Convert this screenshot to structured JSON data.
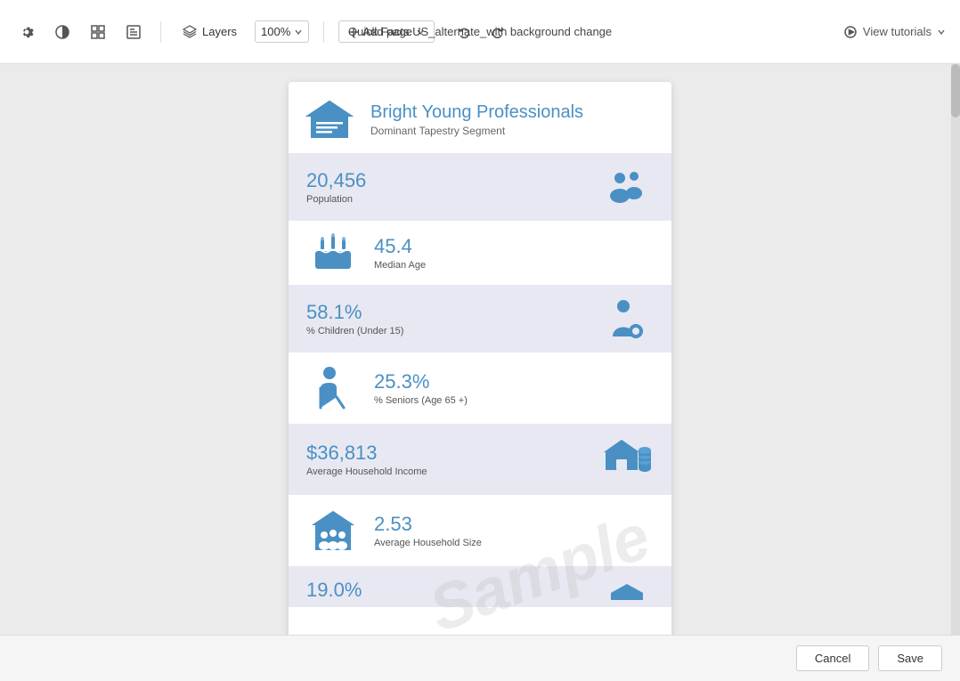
{
  "topbar": {
    "title": "Quick Facts US_alternate_with background change",
    "layers_label": "Layers",
    "zoom_label": "100%",
    "add_page_label": "Add page",
    "view_tutorials_label": "View tutorials"
  },
  "card": {
    "header": {
      "title": "Bright Young Professionals",
      "subtitle": "Dominant Tapestry Segment"
    },
    "stats": [
      {
        "value": "20,456",
        "label": "Population",
        "shaded": true,
        "has_right_icon": true
      },
      {
        "value": "45.4",
        "label": "Median Age",
        "shaded": false,
        "has_right_icon": false
      },
      {
        "value": "58.1%",
        "label": "% Children (Under 15)",
        "shaded": true,
        "has_right_icon": true
      },
      {
        "value": "25.3%",
        "label": "% Seniors (Age 65 +)",
        "shaded": false,
        "has_right_icon": false
      },
      {
        "value": "$36,813",
        "label": "Average Household Income",
        "shaded": true,
        "has_right_icon": true
      },
      {
        "value": "2.53",
        "label": "Average Household Size",
        "shaded": false,
        "has_right_icon": false
      },
      {
        "value": "19.0%",
        "label": "",
        "shaded": true,
        "has_right_icon": true,
        "partial": true
      }
    ]
  },
  "buttons": {
    "cancel": "Cancel",
    "save": "Save"
  },
  "watermark": "Sample"
}
